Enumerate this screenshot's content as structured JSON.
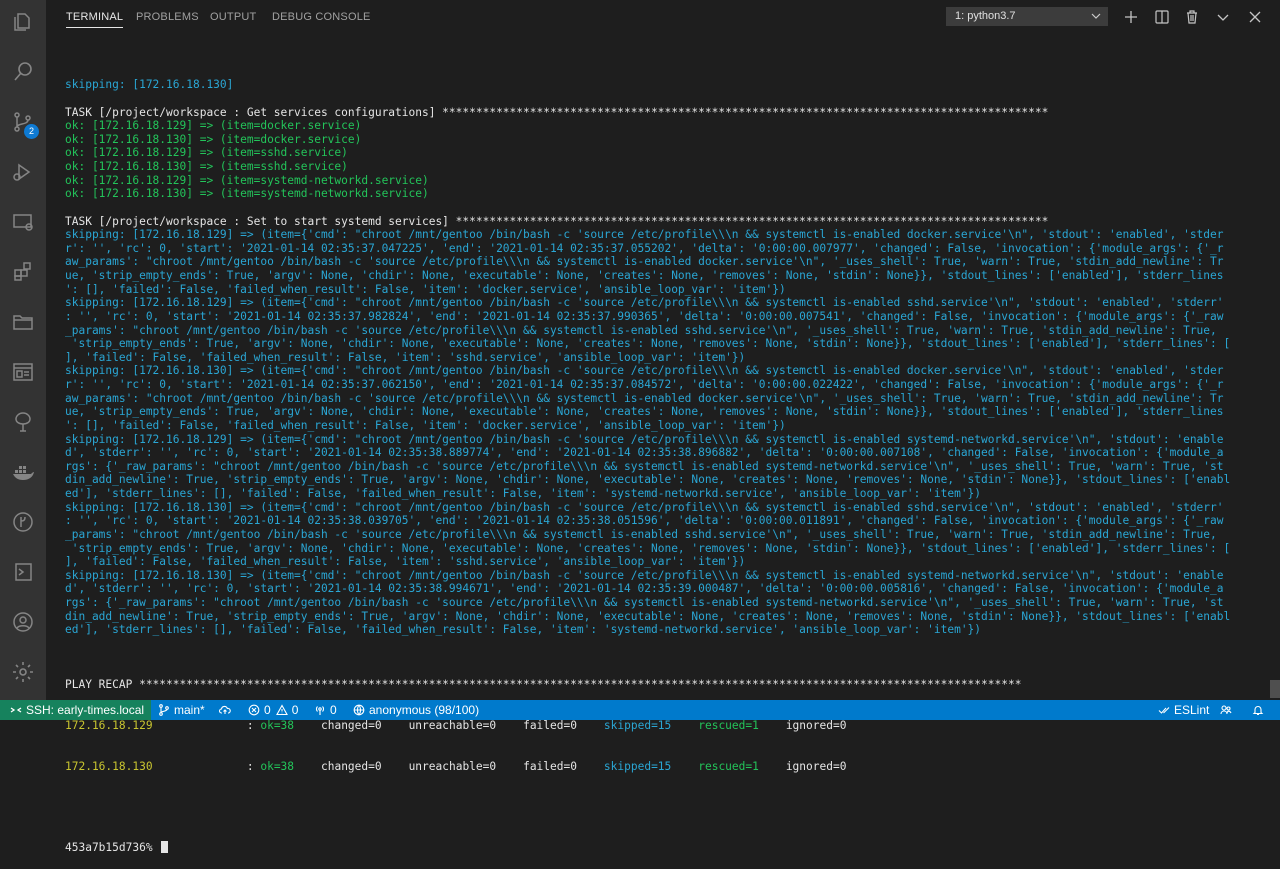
{
  "panel": {
    "tabs": [
      "TERMINAL",
      "PROBLEMS",
      "OUTPUT",
      "DEBUG CONSOLE"
    ],
    "terminal_select": "1: python3.7"
  },
  "activity_bar": {
    "source_control_badge": "2"
  },
  "terminal": {
    "lines": [
      {
        "text": "skipping: [172.16.18.130]",
        "color": "cyan"
      },
      {
        "text": "",
        "color": "white"
      },
      {
        "text": "TASK [/project/workspace : Get services configurations] ******************************************************************************************",
        "color": "white"
      },
      {
        "text": "ok: [172.16.18.129] => (item=docker.service)",
        "color": "green"
      },
      {
        "text": "ok: [172.16.18.130] => (item=docker.service)",
        "color": "green"
      },
      {
        "text": "ok: [172.16.18.129] => (item=sshd.service)",
        "color": "green"
      },
      {
        "text": "ok: [172.16.18.130] => (item=sshd.service)",
        "color": "green"
      },
      {
        "text": "ok: [172.16.18.129] => (item=systemd-networkd.service)",
        "color": "green"
      },
      {
        "text": "ok: [172.16.18.130] => (item=systemd-networkd.service)",
        "color": "green"
      },
      {
        "text": "",
        "color": "white"
      },
      {
        "text": "TASK [/project/workspace : Set to start systemd services] ****************************************************************************************",
        "color": "white"
      },
      {
        "text": "skipping: [172.16.18.129] => (item={'cmd': \"chroot /mnt/gentoo /bin/bash -c 'source /etc/profile\\\\\\n && systemctl is-enabled docker.service'\\n\", 'stdout': 'enabled', 'stder",
        "color": "cyan"
      },
      {
        "text": "r': '', 'rc': 0, 'start': '2021-01-14 02:35:37.047225', 'end': '2021-01-14 02:35:37.055202', 'delta': '0:00:00.007977', 'changed': False, 'invocation': {'module_args': {'_r",
        "color": "cyan"
      },
      {
        "text": "aw_params': \"chroot /mnt/gentoo /bin/bash -c 'source /etc/profile\\\\\\n && systemctl is-enabled docker.service'\\n\", '_uses_shell': True, 'warn': True, 'stdin_add_newline': Tr",
        "color": "cyan"
      },
      {
        "text": "ue, 'strip_empty_ends': True, 'argv': None, 'chdir': None, 'executable': None, 'creates': None, 'removes': None, 'stdin': None}}, 'stdout_lines': ['enabled'], 'stderr_lines",
        "color": "cyan"
      },
      {
        "text": "': [], 'failed': False, 'failed_when_result': False, 'item': 'docker.service', 'ansible_loop_var': 'item'})",
        "color": "cyan"
      },
      {
        "text": "skipping: [172.16.18.129] => (item={'cmd': \"chroot /mnt/gentoo /bin/bash -c 'source /etc/profile\\\\\\n && systemctl is-enabled sshd.service'\\n\", 'stdout': 'enabled', 'stderr'",
        "color": "cyan"
      },
      {
        "text": ": '', 'rc': 0, 'start': '2021-01-14 02:35:37.982824', 'end': '2021-01-14 02:35:37.990365', 'delta': '0:00:00.007541', 'changed': False, 'invocation': {'module_args': {'_raw",
        "color": "cyan"
      },
      {
        "text": "_params': \"chroot /mnt/gentoo /bin/bash -c 'source /etc/profile\\\\\\n && systemctl is-enabled sshd.service'\\n\", '_uses_shell': True, 'warn': True, 'stdin_add_newline': True,",
        "color": "cyan"
      },
      {
        "text": " 'strip_empty_ends': True, 'argv': None, 'chdir': None, 'executable': None, 'creates': None, 'removes': None, 'stdin': None}}, 'stdout_lines': ['enabled'], 'stderr_lines': [",
        "color": "cyan"
      },
      {
        "text": "], 'failed': False, 'failed_when_result': False, 'item': 'sshd.service', 'ansible_loop_var': 'item'})",
        "color": "cyan"
      },
      {
        "text": "skipping: [172.16.18.130] => (item={'cmd': \"chroot /mnt/gentoo /bin/bash -c 'source /etc/profile\\\\\\n && systemctl is-enabled docker.service'\\n\", 'stdout': 'enabled', 'stder",
        "color": "cyan"
      },
      {
        "text": "r': '', 'rc': 0, 'start': '2021-01-14 02:35:37.062150', 'end': '2021-01-14 02:35:37.084572', 'delta': '0:00:00.022422', 'changed': False, 'invocation': {'module_args': {'_r",
        "color": "cyan"
      },
      {
        "text": "aw_params': \"chroot /mnt/gentoo /bin/bash -c 'source /etc/profile\\\\\\n && systemctl is-enabled docker.service'\\n\", '_uses_shell': True, 'warn': True, 'stdin_add_newline': Tr",
        "color": "cyan"
      },
      {
        "text": "ue, 'strip_empty_ends': True, 'argv': None, 'chdir': None, 'executable': None, 'creates': None, 'removes': None, 'stdin': None}}, 'stdout_lines': ['enabled'], 'stderr_lines",
        "color": "cyan"
      },
      {
        "text": "': [], 'failed': False, 'failed_when_result': False, 'item': 'docker.service', 'ansible_loop_var': 'item'})",
        "color": "cyan"
      },
      {
        "text": "skipping: [172.16.18.129] => (item={'cmd': \"chroot /mnt/gentoo /bin/bash -c 'source /etc/profile\\\\\\n && systemctl is-enabled systemd-networkd.service'\\n\", 'stdout': 'enable",
        "color": "cyan"
      },
      {
        "text": "d', 'stderr': '', 'rc': 0, 'start': '2021-01-14 02:35:38.889774', 'end': '2021-01-14 02:35:38.896882', 'delta': '0:00:00.007108', 'changed': False, 'invocation': {'module_a",
        "color": "cyan"
      },
      {
        "text": "rgs': {'_raw_params': \"chroot /mnt/gentoo /bin/bash -c 'source /etc/profile\\\\\\n && systemctl is-enabled systemd-networkd.service'\\n\", '_uses_shell': True, 'warn': True, 'st",
        "color": "cyan"
      },
      {
        "text": "din_add_newline': True, 'strip_empty_ends': True, 'argv': None, 'chdir': None, 'executable': None, 'creates': None, 'removes': None, 'stdin': None}}, 'stdout_lines': ['enabl",
        "color": "cyan"
      },
      {
        "text": "ed'], 'stderr_lines': [], 'failed': False, 'failed_when_result': False, 'item': 'systemd-networkd.service', 'ansible_loop_var': 'item'})",
        "color": "cyan"
      },
      {
        "text": "skipping: [172.16.18.130] => (item={'cmd': \"chroot /mnt/gentoo /bin/bash -c 'source /etc/profile\\\\\\n && systemctl is-enabled sshd.service'\\n\", 'stdout': 'enabled', 'stderr'",
        "color": "cyan"
      },
      {
        "text": ": '', 'rc': 0, 'start': '2021-01-14 02:35:38.039705', 'end': '2021-01-14 02:35:38.051596', 'delta': '0:00:00.011891', 'changed': False, 'invocation': {'module_args': {'_raw",
        "color": "cyan"
      },
      {
        "text": "_params': \"chroot /mnt/gentoo /bin/bash -c 'source /etc/profile\\\\\\n && systemctl is-enabled sshd.service'\\n\", '_uses_shell': True, 'warn': True, 'stdin_add_newline': True,",
        "color": "cyan"
      },
      {
        "text": " 'strip_empty_ends': True, 'argv': None, 'chdir': None, 'executable': None, 'creates': None, 'removes': None, 'stdin': None}}, 'stdout_lines': ['enabled'], 'stderr_lines': [",
        "color": "cyan"
      },
      {
        "text": "], 'failed': False, 'failed_when_result': False, 'item': 'sshd.service', 'ansible_loop_var': 'item'})",
        "color": "cyan"
      },
      {
        "text": "skipping: [172.16.18.130] => (item={'cmd': \"chroot /mnt/gentoo /bin/bash -c 'source /etc/profile\\\\\\n && systemctl is-enabled systemd-networkd.service'\\n\", 'stdout': 'enable",
        "color": "cyan"
      },
      {
        "text": "d', 'stderr': '', 'rc': 0, 'start': '2021-01-14 02:35:38.994671', 'end': '2021-01-14 02:35:39.000487', 'delta': '0:00:00.005816', 'changed': False, 'invocation': {'module_a",
        "color": "cyan"
      },
      {
        "text": "rgs': {'_raw_params': \"chroot /mnt/gentoo /bin/bash -c 'source /etc/profile\\\\\\n && systemctl is-enabled systemd-networkd.service'\\n\", '_uses_shell': True, 'warn': True, 'st",
        "color": "cyan"
      },
      {
        "text": "din_add_newline': True, 'strip_empty_ends': True, 'argv': None, 'chdir': None, 'executable': None, 'creates': None, 'removes': None, 'stdin': None}}, 'stdout_lines': ['enabl",
        "color": "cyan"
      },
      {
        "text": "ed'], 'stderr_lines': [], 'failed': False, 'failed_when_result': False, 'item': 'systemd-networkd.service', 'ansible_loop_var': 'item'})",
        "color": "cyan"
      },
      {
        "text": "",
        "color": "white"
      }
    ],
    "recap_header": "PLAY RECAP ***********************************************************************************************************************************",
    "recap_rows": [
      {
        "host": "172.16.18.129",
        "ok": "ok=38",
        "changed": "changed=0",
        "unreachable": "unreachable=0",
        "failed": "failed=0",
        "skipped": "skipped=15",
        "rescued": "rescued=1",
        "ignored": "ignored=0"
      },
      {
        "host": "172.16.18.130",
        "ok": "ok=38",
        "changed": "changed=0",
        "unreachable": "unreachable=0",
        "failed": "failed=0",
        "skipped": "skipped=15",
        "rescued": "rescued=1",
        "ignored": "ignored=0"
      }
    ],
    "prompt": "453a7b15d736%"
  },
  "status_bar": {
    "remote": "SSH: early-times.local",
    "branch": "main*",
    "errors": "0",
    "warnings": "0",
    "ports": "0",
    "account": "anonymous (98/100)",
    "eslint": "ESLint"
  },
  "colors": {
    "white": "#e5e5e5",
    "cyan": "#2aa6d4",
    "green": "#23c45a",
    "yellow": "#c9c530",
    "status_bar": "#007acc",
    "remote": "#16825d"
  }
}
